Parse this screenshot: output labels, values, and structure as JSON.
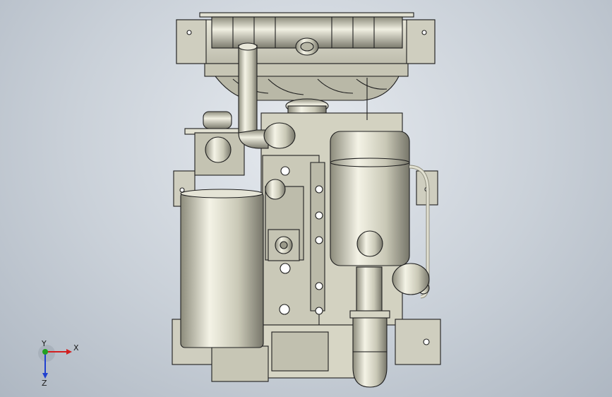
{
  "viewport": {
    "background_colors": [
      "#e6eaef",
      "#c9d0d8",
      "#aeb7c2"
    ]
  },
  "model": {
    "name_icon": "engine-assembly-icon",
    "body_color": "#d9d8c6",
    "shade_color": "#8f8e7e",
    "edge_color": "#1e1e1e"
  },
  "triad": {
    "x_label": "X",
    "y_label": "Y",
    "z_label": "Z",
    "x_color": "#d22020",
    "y_color": "#20a020",
    "z_color": "#2040d0"
  }
}
